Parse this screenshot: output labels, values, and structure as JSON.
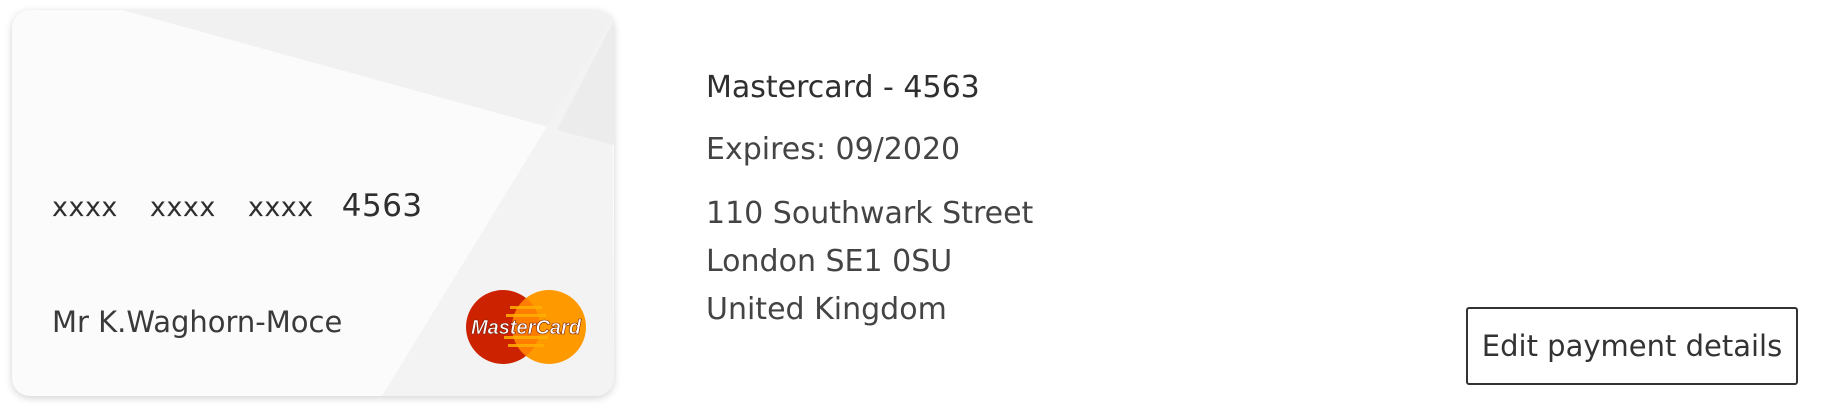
{
  "card": {
    "number_groups": [
      "xxxx",
      "xxxx",
      "xxxx"
    ],
    "last_four": "4563",
    "cardholder": "Mr K.Waghorn-Moce",
    "brand_logo_text": "MasterCard",
    "brand_colors": {
      "left": "#cc2200",
      "right": "#ff9900"
    },
    "icon": "mastercard-logo-icon"
  },
  "details": {
    "title": "Mastercard - 4563",
    "expires": "Expires: 09/2020",
    "address": [
      "110 Southwark Street",
      "London SE1 0SU",
      "United Kingdom"
    ]
  },
  "actions": {
    "edit_label": "Edit payment details"
  }
}
